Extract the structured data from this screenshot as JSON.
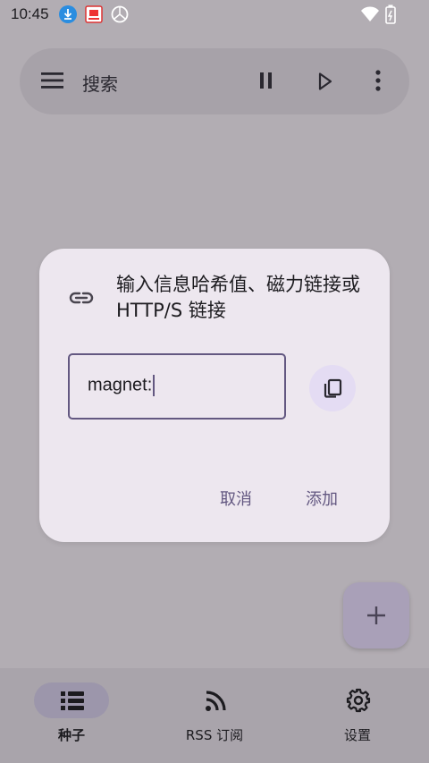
{
  "status_bar": {
    "time": "10:45"
  },
  "search_bar": {
    "label": "搜索"
  },
  "dialog": {
    "title": "输入信息哈希值、磁力链接或 HTTP/S 链接",
    "input_value": "magnet:",
    "cancel_label": "取消",
    "add_label": "添加"
  },
  "bottom_nav": {
    "items": [
      {
        "label": "种子",
        "icon": "list-icon",
        "selected": true
      },
      {
        "label": "RSS 订阅",
        "icon": "rss-icon",
        "selected": false
      },
      {
        "label": "设置",
        "icon": "gear-icon",
        "selected": false
      }
    ]
  },
  "colors": {
    "accent": "#635881",
    "dialog_bg": "#ede7ef",
    "scrim_bg": "#b2adb3"
  }
}
